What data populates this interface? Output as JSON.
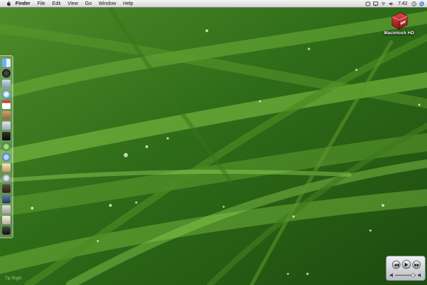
{
  "menubar": {
    "app_name": "Finder",
    "menus": [
      "File",
      "Edit",
      "View",
      "Go",
      "Window",
      "Help"
    ],
    "clock": "7:42",
    "status_icons": [
      "sync-icon",
      "display-icon",
      "airport-icon",
      "volume-icon",
      "clock-icon",
      "spotlight-icon"
    ]
  },
  "desktop": {
    "items": [
      {
        "label": "Macintosh HD",
        "icon": "hard-drive-icon"
      }
    ]
  },
  "dock": {
    "items": [
      "finder-icon",
      "dashboard-icon",
      "mail-icon",
      "safari-icon",
      "ical-icon",
      "address-book-icon",
      "itunes-icon",
      "iphoto-icon",
      "preview-icon",
      "system-preferences-icon",
      "textedit-icon",
      "terminal-icon",
      "chess-icon",
      "dvd-player-icon",
      "quicktime-icon",
      "downloads-stack-icon",
      "trash-icon"
    ]
  },
  "remote": {
    "controls": [
      "rewind",
      "play",
      "fast-forward"
    ]
  },
  "hint": "Tip Right"
}
